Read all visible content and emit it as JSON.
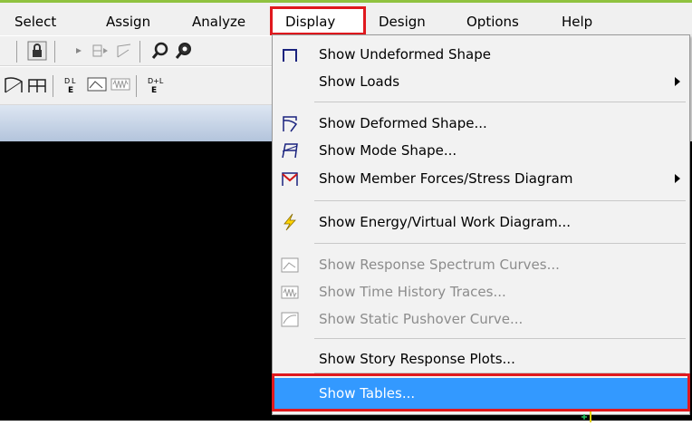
{
  "menubar": {
    "items": [
      {
        "label": "Select"
      },
      {
        "label": "Assign"
      },
      {
        "label": "Analyze"
      },
      {
        "label": "Display"
      },
      {
        "label": "Design"
      },
      {
        "label": "Options"
      },
      {
        "label": "Help"
      }
    ]
  },
  "display_menu": {
    "items": [
      {
        "label": "Show Undeformed Shape",
        "enabled": true
      },
      {
        "label": "Show Loads",
        "enabled": true,
        "submenu": true
      },
      {
        "label": "Show Deformed Shape...",
        "enabled": true
      },
      {
        "label": "Show Mode Shape...",
        "enabled": true
      },
      {
        "label": "Show Member Forces/Stress Diagram",
        "enabled": true,
        "submenu": true
      },
      {
        "label": "Show Energy/Virtual Work Diagram...",
        "enabled": true
      },
      {
        "label": "Show Response Spectrum Curves...",
        "enabled": false
      },
      {
        "label": "Show Time History Traces...",
        "enabled": false
      },
      {
        "label": "Show Static Pushover Curve...",
        "enabled": false
      },
      {
        "label": "Show Story Response Plots...",
        "enabled": true
      },
      {
        "label": "Show Tables...",
        "enabled": true,
        "highlighted": true
      }
    ]
  },
  "colors": {
    "highlight": "#3399ff",
    "annotation_red": "#e0191e",
    "accent_green": "#8fc23f"
  }
}
